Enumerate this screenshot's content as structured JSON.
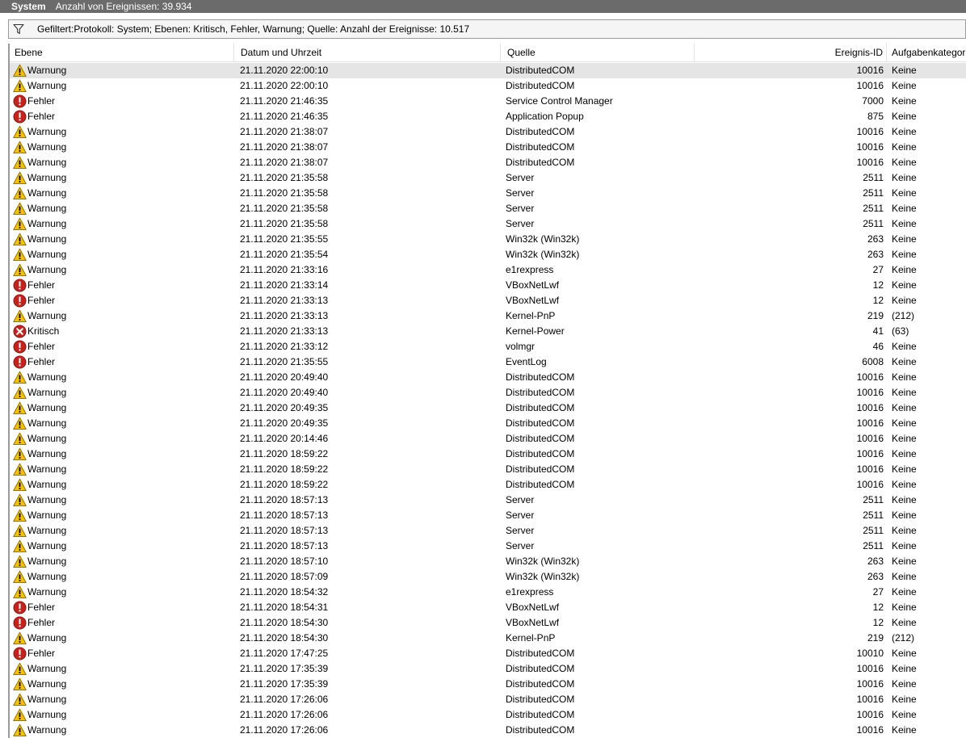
{
  "window": {
    "title": "System",
    "event_count": "Anzahl von Ereignissen: 39.934"
  },
  "filter": {
    "text": "Gefiltert:Protokoll: System; Ebenen: Kritisch, Fehler, Warnung; Quelle:  Anzahl der Ereignisse: 10.517",
    "icon": "filter-funnel-icon"
  },
  "colors": {
    "titlebar": "#6b6b6b",
    "selected_row": "#e5e5e5",
    "warning": "#f6c200",
    "error": "#c8211c",
    "critical": "#c8211c"
  },
  "columns": [
    "Ebene",
    "Datum und Uhrzeit",
    "Quelle",
    "Ereignis-ID",
    "Aufgabenkategor"
  ],
  "rows": [
    {
      "level": "Warnung",
      "icon": "warning-icon",
      "date": "21.11.2020 22:00:10",
      "source": "DistributedCOM",
      "id": "10016",
      "task": "Keine",
      "selected": true
    },
    {
      "level": "Warnung",
      "icon": "warning-icon",
      "date": "21.11.2020 22:00:10",
      "source": "DistributedCOM",
      "id": "10016",
      "task": "Keine"
    },
    {
      "level": "Fehler",
      "icon": "error-icon",
      "date": "21.11.2020 21:46:35",
      "source": "Service Control Manager",
      "id": "7000",
      "task": "Keine"
    },
    {
      "level": "Fehler",
      "icon": "error-icon",
      "date": "21.11.2020 21:46:35",
      "source": "Application Popup",
      "id": "875",
      "task": "Keine"
    },
    {
      "level": "Warnung",
      "icon": "warning-icon",
      "date": "21.11.2020 21:38:07",
      "source": "DistributedCOM",
      "id": "10016",
      "task": "Keine"
    },
    {
      "level": "Warnung",
      "icon": "warning-icon",
      "date": "21.11.2020 21:38:07",
      "source": "DistributedCOM",
      "id": "10016",
      "task": "Keine"
    },
    {
      "level": "Warnung",
      "icon": "warning-icon",
      "date": "21.11.2020 21:38:07",
      "source": "DistributedCOM",
      "id": "10016",
      "task": "Keine"
    },
    {
      "level": "Warnung",
      "icon": "warning-icon",
      "date": "21.11.2020 21:35:58",
      "source": "Server",
      "id": "2511",
      "task": "Keine"
    },
    {
      "level": "Warnung",
      "icon": "warning-icon",
      "date": "21.11.2020 21:35:58",
      "source": "Server",
      "id": "2511",
      "task": "Keine"
    },
    {
      "level": "Warnung",
      "icon": "warning-icon",
      "date": "21.11.2020 21:35:58",
      "source": "Server",
      "id": "2511",
      "task": "Keine"
    },
    {
      "level": "Warnung",
      "icon": "warning-icon",
      "date": "21.11.2020 21:35:58",
      "source": "Server",
      "id": "2511",
      "task": "Keine"
    },
    {
      "level": "Warnung",
      "icon": "warning-icon",
      "date": "21.11.2020 21:35:55",
      "source": "Win32k (Win32k)",
      "id": "263",
      "task": "Keine"
    },
    {
      "level": "Warnung",
      "icon": "warning-icon",
      "date": "21.11.2020 21:35:54",
      "source": "Win32k (Win32k)",
      "id": "263",
      "task": "Keine"
    },
    {
      "level": "Warnung",
      "icon": "warning-icon",
      "date": "21.11.2020 21:33:16",
      "source": "e1rexpress",
      "id": "27",
      "task": "Keine"
    },
    {
      "level": "Fehler",
      "icon": "error-icon",
      "date": "21.11.2020 21:33:14",
      "source": "VBoxNetLwf",
      "id": "12",
      "task": "Keine"
    },
    {
      "level": "Fehler",
      "icon": "error-icon",
      "date": "21.11.2020 21:33:13",
      "source": "VBoxNetLwf",
      "id": "12",
      "task": "Keine"
    },
    {
      "level": "Warnung",
      "icon": "warning-icon",
      "date": "21.11.2020 21:33:13",
      "source": "Kernel-PnP",
      "id": "219",
      "task": "(212)"
    },
    {
      "level": "Kritisch",
      "icon": "critical-icon",
      "date": "21.11.2020 21:33:13",
      "source": "Kernel-Power",
      "id": "41",
      "task": "(63)"
    },
    {
      "level": "Fehler",
      "icon": "error-icon",
      "date": "21.11.2020 21:33:12",
      "source": "volmgr",
      "id": "46",
      "task": "Keine"
    },
    {
      "level": "Fehler",
      "icon": "error-icon",
      "date": "21.11.2020 21:35:55",
      "source": "EventLog",
      "id": "6008",
      "task": "Keine"
    },
    {
      "level": "Warnung",
      "icon": "warning-icon",
      "date": "21.11.2020 20:49:40",
      "source": "DistributedCOM",
      "id": "10016",
      "task": "Keine"
    },
    {
      "level": "Warnung",
      "icon": "warning-icon",
      "date": "21.11.2020 20:49:40",
      "source": "DistributedCOM",
      "id": "10016",
      "task": "Keine"
    },
    {
      "level": "Warnung",
      "icon": "warning-icon",
      "date": "21.11.2020 20:49:35",
      "source": "DistributedCOM",
      "id": "10016",
      "task": "Keine"
    },
    {
      "level": "Warnung",
      "icon": "warning-icon",
      "date": "21.11.2020 20:49:35",
      "source": "DistributedCOM",
      "id": "10016",
      "task": "Keine"
    },
    {
      "level": "Warnung",
      "icon": "warning-icon",
      "date": "21.11.2020 20:14:46",
      "source": "DistributedCOM",
      "id": "10016",
      "task": "Keine"
    },
    {
      "level": "Warnung",
      "icon": "warning-icon",
      "date": "21.11.2020 18:59:22",
      "source": "DistributedCOM",
      "id": "10016",
      "task": "Keine"
    },
    {
      "level": "Warnung",
      "icon": "warning-icon",
      "date": "21.11.2020 18:59:22",
      "source": "DistributedCOM",
      "id": "10016",
      "task": "Keine"
    },
    {
      "level": "Warnung",
      "icon": "warning-icon",
      "date": "21.11.2020 18:59:22",
      "source": "DistributedCOM",
      "id": "10016",
      "task": "Keine"
    },
    {
      "level": "Warnung",
      "icon": "warning-icon",
      "date": "21.11.2020 18:57:13",
      "source": "Server",
      "id": "2511",
      "task": "Keine"
    },
    {
      "level": "Warnung",
      "icon": "warning-icon",
      "date": "21.11.2020 18:57:13",
      "source": "Server",
      "id": "2511",
      "task": "Keine"
    },
    {
      "level": "Warnung",
      "icon": "warning-icon",
      "date": "21.11.2020 18:57:13",
      "source": "Server",
      "id": "2511",
      "task": "Keine"
    },
    {
      "level": "Warnung",
      "icon": "warning-icon",
      "date": "21.11.2020 18:57:13",
      "source": "Server",
      "id": "2511",
      "task": "Keine"
    },
    {
      "level": "Warnung",
      "icon": "warning-icon",
      "date": "21.11.2020 18:57:10",
      "source": "Win32k (Win32k)",
      "id": "263",
      "task": "Keine"
    },
    {
      "level": "Warnung",
      "icon": "warning-icon",
      "date": "21.11.2020 18:57:09",
      "source": "Win32k (Win32k)",
      "id": "263",
      "task": "Keine"
    },
    {
      "level": "Warnung",
      "icon": "warning-icon",
      "date": "21.11.2020 18:54:32",
      "source": "e1rexpress",
      "id": "27",
      "task": "Keine"
    },
    {
      "level": "Fehler",
      "icon": "error-icon",
      "date": "21.11.2020 18:54:31",
      "source": "VBoxNetLwf",
      "id": "12",
      "task": "Keine"
    },
    {
      "level": "Fehler",
      "icon": "error-icon",
      "date": "21.11.2020 18:54:30",
      "source": "VBoxNetLwf",
      "id": "12",
      "task": "Keine"
    },
    {
      "level": "Warnung",
      "icon": "warning-icon",
      "date": "21.11.2020 18:54:30",
      "source": "Kernel-PnP",
      "id": "219",
      "task": "(212)"
    },
    {
      "level": "Fehler",
      "icon": "error-icon",
      "date": "21.11.2020 17:47:25",
      "source": "DistributedCOM",
      "id": "10010",
      "task": "Keine"
    },
    {
      "level": "Warnung",
      "icon": "warning-icon",
      "date": "21.11.2020 17:35:39",
      "source": "DistributedCOM",
      "id": "10016",
      "task": "Keine"
    },
    {
      "level": "Warnung",
      "icon": "warning-icon",
      "date": "21.11.2020 17:35:39",
      "source": "DistributedCOM",
      "id": "10016",
      "task": "Keine"
    },
    {
      "level": "Warnung",
      "icon": "warning-icon",
      "date": "21.11.2020 17:26:06",
      "source": "DistributedCOM",
      "id": "10016",
      "task": "Keine"
    },
    {
      "level": "Warnung",
      "icon": "warning-icon",
      "date": "21.11.2020 17:26:06",
      "source": "DistributedCOM",
      "id": "10016",
      "task": "Keine"
    },
    {
      "level": "Warnung",
      "icon": "warning-icon",
      "date": "21.11.2020 17:26:06",
      "source": "DistributedCOM",
      "id": "10016",
      "task": "Keine"
    }
  ]
}
